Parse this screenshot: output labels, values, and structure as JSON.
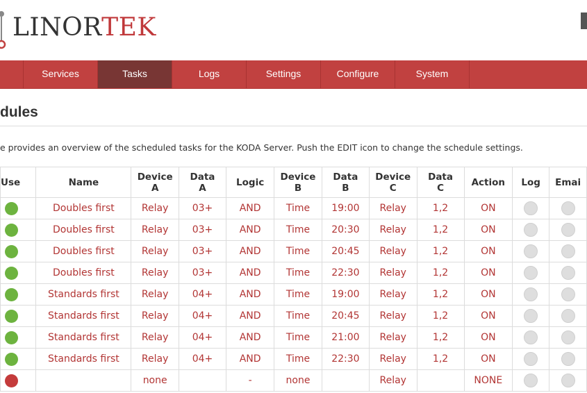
{
  "brand": {
    "text_main": "LINOR",
    "text_accent": "TEK"
  },
  "nav": {
    "items": [
      {
        "label": "Services",
        "active": false
      },
      {
        "label": "Tasks",
        "active": true
      },
      {
        "label": "Logs",
        "active": false
      },
      {
        "label": "Settings",
        "active": false
      },
      {
        "label": "Configure",
        "active": false
      },
      {
        "label": "System",
        "active": false
      }
    ]
  },
  "page": {
    "title": "dules",
    "description": "e provides an overview of the scheduled tasks for the KODA Server. Push the EDIT icon to change the schedule settings."
  },
  "table": {
    "headers": [
      {
        "line1": "Use",
        "line2": ""
      },
      {
        "line1": "Name",
        "line2": ""
      },
      {
        "line1": "Device",
        "line2": "A"
      },
      {
        "line1": "Data",
        "line2": "A"
      },
      {
        "line1": "Logic",
        "line2": ""
      },
      {
        "line1": "Device",
        "line2": "B"
      },
      {
        "line1": "Data",
        "line2": "B"
      },
      {
        "line1": "Device",
        "line2": "C"
      },
      {
        "line1": "Data",
        "line2": "C"
      },
      {
        "line1": "Action",
        "line2": ""
      },
      {
        "line1": "Log",
        "line2": ""
      },
      {
        "line1": "Emai",
        "line2": ""
      }
    ],
    "rows": [
      {
        "use": "green",
        "name": "Doubles first",
        "device_a": "Relay",
        "data_a": "03+",
        "logic": "AND",
        "device_b": "Time",
        "data_b": "19:00",
        "device_c": "Relay",
        "data_c": "1,2",
        "action": "ON",
        "log": "off",
        "email": "off"
      },
      {
        "use": "green",
        "name": "Doubles first",
        "device_a": "Relay",
        "data_a": "03+",
        "logic": "AND",
        "device_b": "Time",
        "data_b": "20:30",
        "device_c": "Relay",
        "data_c": "1,2",
        "action": "ON",
        "log": "off",
        "email": "off"
      },
      {
        "use": "green",
        "name": "Doubles first",
        "device_a": "Relay",
        "data_a": "03+",
        "logic": "AND",
        "device_b": "Time",
        "data_b": "20:45",
        "device_c": "Relay",
        "data_c": "1,2",
        "action": "ON",
        "log": "off",
        "email": "off"
      },
      {
        "use": "green",
        "name": "Doubles first",
        "device_a": "Relay",
        "data_a": "03+",
        "logic": "AND",
        "device_b": "Time",
        "data_b": "22:30",
        "device_c": "Relay",
        "data_c": "1,2",
        "action": "ON",
        "log": "off",
        "email": "off"
      },
      {
        "use": "green",
        "name": "Standards first",
        "device_a": "Relay",
        "data_a": "04+",
        "logic": "AND",
        "device_b": "Time",
        "data_b": "19:00",
        "device_c": "Relay",
        "data_c": "1,2",
        "action": "ON",
        "log": "off",
        "email": "off"
      },
      {
        "use": "green",
        "name": "Standards first",
        "device_a": "Relay",
        "data_a": "04+",
        "logic": "AND",
        "device_b": "Time",
        "data_b": "20:45",
        "device_c": "Relay",
        "data_c": "1,2",
        "action": "ON",
        "log": "off",
        "email": "off"
      },
      {
        "use": "green",
        "name": "Standards first",
        "device_a": "Relay",
        "data_a": "04+",
        "logic": "AND",
        "device_b": "Time",
        "data_b": "21:00",
        "device_c": "Relay",
        "data_c": "1,2",
        "action": "ON",
        "log": "off",
        "email": "off"
      },
      {
        "use": "green",
        "name": "Standards first",
        "device_a": "Relay",
        "data_a": "04+",
        "logic": "AND",
        "device_b": "Time",
        "data_b": "22:30",
        "device_c": "Relay",
        "data_c": "1,2",
        "action": "ON",
        "log": "off",
        "email": "off"
      },
      {
        "use": "red",
        "name": "",
        "device_a": "none",
        "data_a": "",
        "logic": "-",
        "device_b": "none",
        "data_b": "",
        "device_c": "Relay",
        "data_c": "",
        "action": "NONE",
        "log": "off",
        "email": "off"
      }
    ]
  },
  "colors": {
    "brand_red": "#c14140",
    "nav_active": "#783634",
    "status_on": "#6db33f",
    "status_off": "#c43b3b",
    "indicator_inactive": "#dedede",
    "cell_text": "#b23534"
  }
}
